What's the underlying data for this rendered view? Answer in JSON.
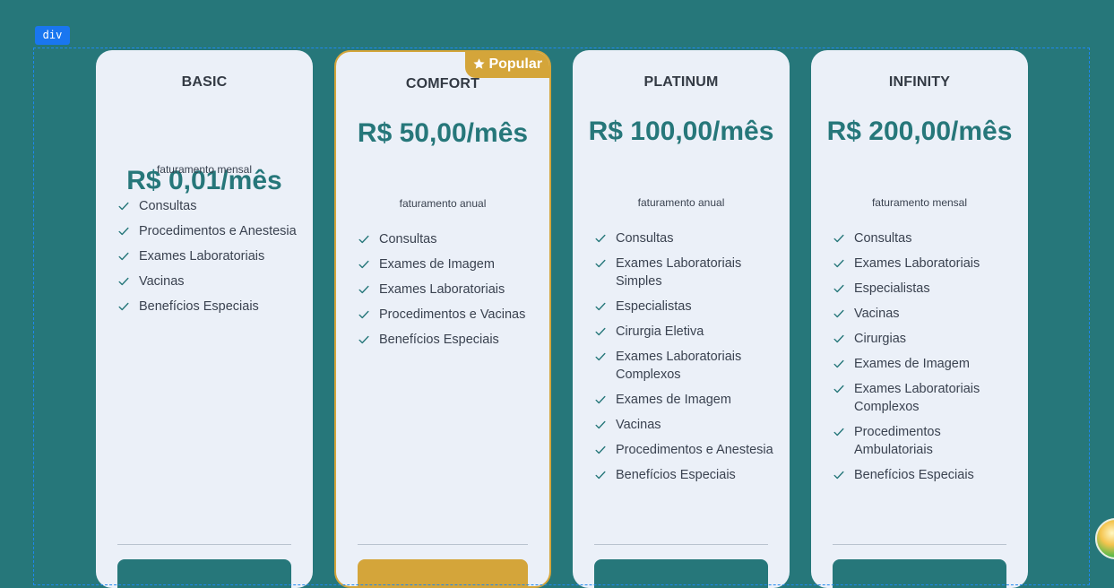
{
  "inspector": {
    "tag_label": "div"
  },
  "plans": [
    {
      "name": "BASIC",
      "price": "R$ 0,01/mês",
      "billing": "faturamento mensal",
      "popular": false,
      "features": [
        "Consultas",
        "Procedimentos e Anestesia",
        "Exames Laboratoriais",
        "Vacinas",
        "Benefícios Especiais"
      ]
    },
    {
      "name": "COMFORT",
      "price": "R$ 50,00/mês",
      "billing": "faturamento anual",
      "popular": true,
      "badge": "Popular",
      "features": [
        "Consultas",
        "Exames de Imagem",
        "Exames Laboratoriais",
        "Procedimentos e Vacinas",
        "Benefícios Especiais"
      ]
    },
    {
      "name": "PLATINUM",
      "price": "R$ 100,00/mês",
      "billing": "faturamento anual",
      "popular": false,
      "features": [
        "Consultas",
        "Exames Laboratoriais Simples",
        "Especialistas",
        "Cirurgia Eletiva",
        "Exames Laboratoriais Complexos",
        "Exames de Imagem",
        "Vacinas",
        "Procedimentos e Anestesia",
        "Benefícios Especiais"
      ]
    },
    {
      "name": "INFINITY",
      "price": "R$ 200,00/mês",
      "billing": "faturamento mensal",
      "popular": false,
      "features": [
        "Consultas",
        "Exames Laboratoriais",
        "Especialistas",
        "Vacinas",
        "Cirurgias",
        "Exames de Imagem",
        "Exames Laboratoriais Complexos",
        "Procedimentos Ambulatoriais",
        "Benefícios Especiais"
      ]
    }
  ],
  "icons": {
    "feature": "check-icon",
    "badge": "star-icon"
  },
  "colors": {
    "background": "#26777a",
    "card": "#ebf0f8",
    "accent": "#26777a",
    "popular": "#d4a53a"
  }
}
